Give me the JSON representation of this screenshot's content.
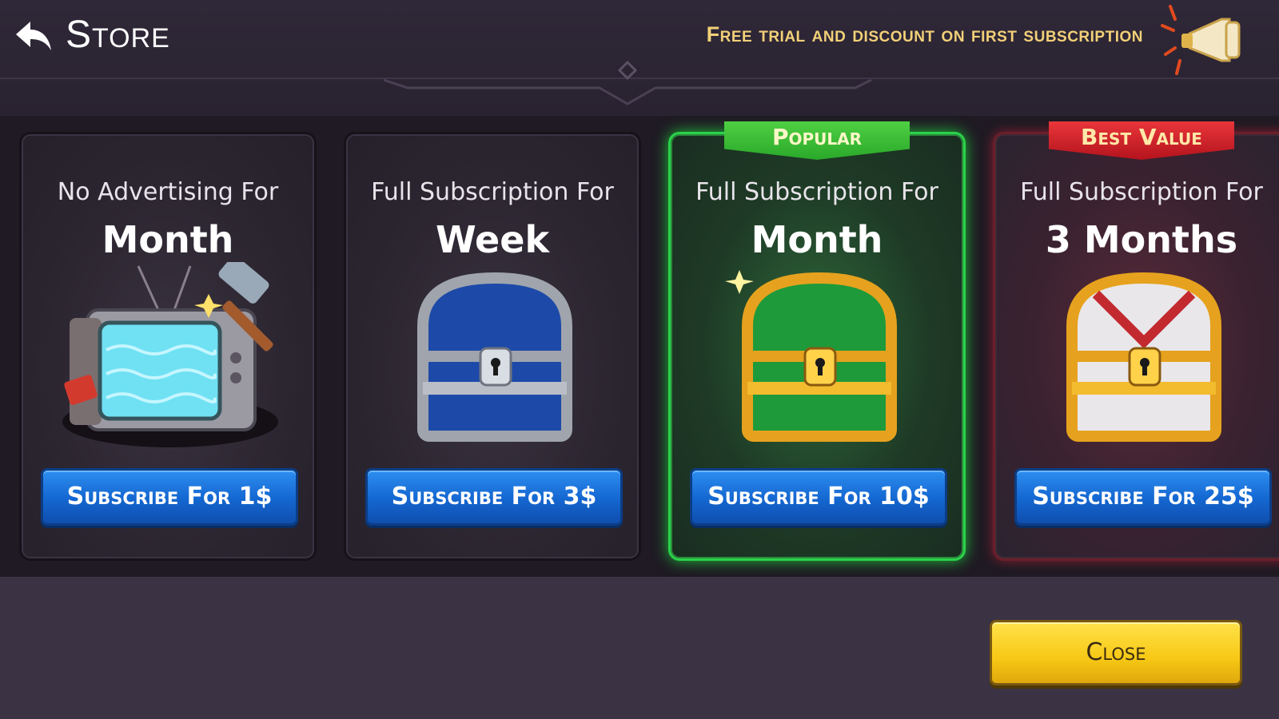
{
  "header": {
    "title": "Store",
    "back_icon": "back-arrow-icon",
    "promo_text": "Free trial and discount on first subscription",
    "promo_icon": "megaphone-icon"
  },
  "cards": [
    {
      "subtitle": "No Advertising For",
      "period": "Month",
      "button_label": "Subscribe For 1$",
      "ribbon": null,
      "art_icon": "ad-tv-hammer-icon",
      "highlight": "none"
    },
    {
      "subtitle": "Full Subscription For",
      "period": "Week",
      "button_label": "Subscribe For 3$",
      "ribbon": null,
      "art_icon": "silver-chest-icon",
      "highlight": "none"
    },
    {
      "subtitle": "Full Subscription For",
      "period": "Month",
      "button_label": "Subscribe For 10$",
      "ribbon": "Popular",
      "art_icon": "gold-green-chest-icon",
      "highlight": "#2bd24a"
    },
    {
      "subtitle": "Full Subscription For",
      "period": "3 Months",
      "button_label": "Subscribe For 25$",
      "ribbon": "Best Value",
      "art_icon": "gold-red-chest-icon",
      "highlight": "#b4131d"
    }
  ],
  "footer": {
    "close_label": "Close"
  },
  "colors": {
    "accent_blue": "#1466d0",
    "accent_yellow": "#f7c815",
    "promo_gold": "#f2d078"
  }
}
